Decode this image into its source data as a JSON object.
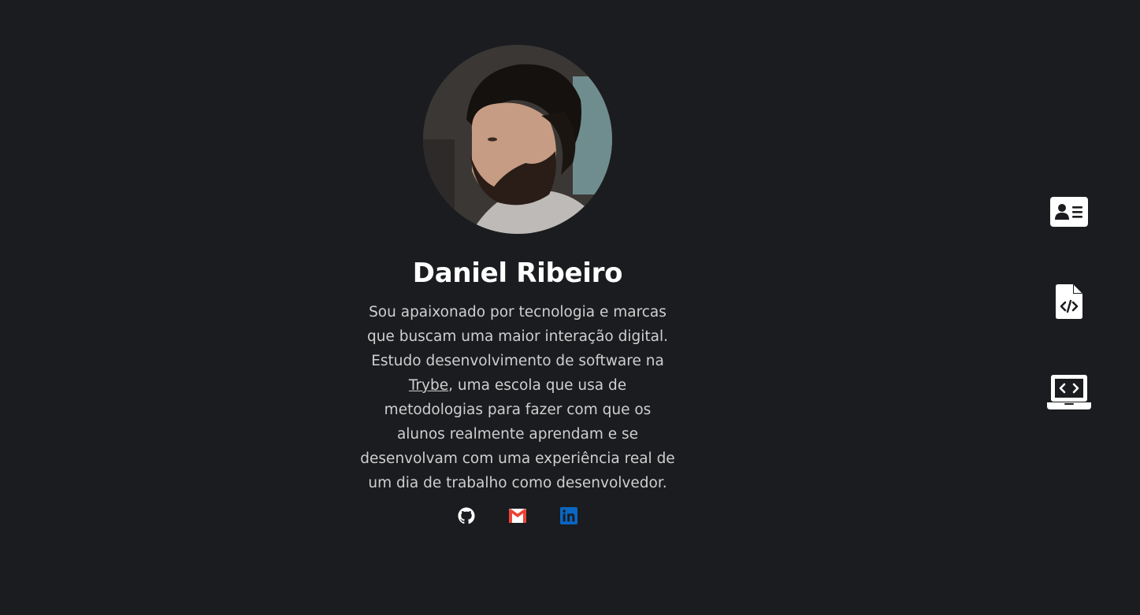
{
  "profile": {
    "name": "Daniel Ribeiro",
    "bio_before_link": "Sou apaixonado por tecnologia e marcas que buscam uma maior interação digital. Estudo desenvolvimento de software na ",
    "bio_link_text": "Trybe",
    "bio_after_link": ", uma escola que usa de metodologias para fazer com que os alunos realmente aprendam e se desenvolvam com uma experiência real de um dia de trabalho como desenvolvedor."
  },
  "socials": [
    {
      "icon": "github-icon",
      "color": "#ffffff"
    },
    {
      "icon": "gmail-icon",
      "color": "#ea4335"
    },
    {
      "icon": "linkedin-icon",
      "color": "#0a66c2"
    }
  ],
  "side_nav": [
    {
      "icon": "contact-card-icon"
    },
    {
      "icon": "code-file-icon"
    },
    {
      "icon": "laptop-code-icon"
    }
  ],
  "colors": {
    "background": "#1b1c1f",
    "text": "#ffffff",
    "bio_text": "#cfcfcf"
  }
}
